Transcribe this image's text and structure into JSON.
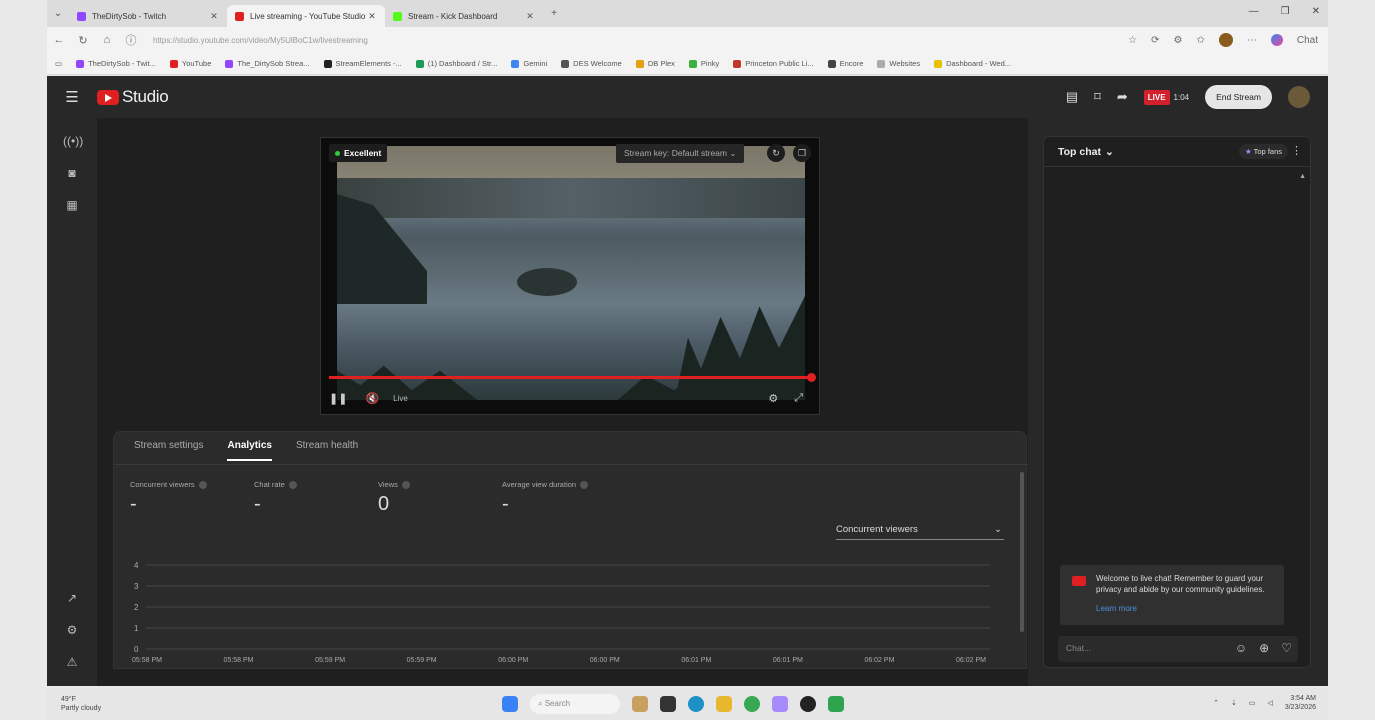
{
  "browser": {
    "tabs": [
      {
        "title": "TheDirtySob - Twitch",
        "color": "#9146ff"
      },
      {
        "title": "Live streaming - YouTube Studio",
        "color": "#e02020"
      },
      {
        "title": "Stream - Kick Dashboard",
        "color": "#53fc18"
      }
    ],
    "url": "https://studio.youtube.com/video/My5UlBoC1w/livestreaming",
    "profile_label": "Chat",
    "bookmarks": [
      "TheDirtySob - Twit...",
      "YouTube",
      "The_DirtySob Strea...",
      "StreamElements -...",
      "(1) Dashboard / Str...",
      "Gemini",
      "DES Welcome",
      "DB Plex",
      "Pinky",
      "Princeton Public Li...",
      "Encore",
      "Websites",
      "Dashboard - Wed..."
    ]
  },
  "studio": {
    "logo_text": "Studio",
    "live_badge": "LIVE",
    "live_time": "1:04",
    "end_stream_label": "End Stream"
  },
  "video": {
    "quality_label": "Excellent",
    "stream_key_label": "Stream key: Default stream",
    "live_label": "Live"
  },
  "analytics": {
    "tabs": [
      "Stream settings",
      "Analytics",
      "Stream health"
    ],
    "active_tab": "Analytics",
    "metrics": [
      {
        "label": "Concurrent viewers",
        "value": "-"
      },
      {
        "label": "Chat rate",
        "value": "-"
      },
      {
        "label": "Views",
        "value": "0"
      },
      {
        "label": "Average view duration",
        "value": "-"
      }
    ],
    "selector_value": "Concurrent viewers"
  },
  "chart_data": {
    "type": "line",
    "title": "",
    "xlabel": "",
    "ylabel": "",
    "x": [
      "05:58 PM",
      "05:58 PM",
      "05:59 PM",
      "05:59 PM",
      "06:00 PM",
      "06:00 PM",
      "06:01 PM",
      "06:01 PM",
      "06:02 PM",
      "06:02 PM"
    ],
    "yticks": [
      0,
      1,
      2,
      3,
      4
    ],
    "ylim": [
      0,
      4
    ],
    "series": [],
    "grid": true
  },
  "chat": {
    "header": "Top chat",
    "top_fans_label": "Top fans",
    "welcome_text": "Welcome to live chat! Remember to guard your privacy and abide by our community guidelines.",
    "learn_more": "Learn more",
    "input_placeholder": "Chat..."
  },
  "taskbar": {
    "weather_temp": "49°F",
    "weather_desc": "Partly cloudy",
    "search_placeholder": "Search",
    "time": "3:54 AM",
    "date": "3/23/2026"
  }
}
